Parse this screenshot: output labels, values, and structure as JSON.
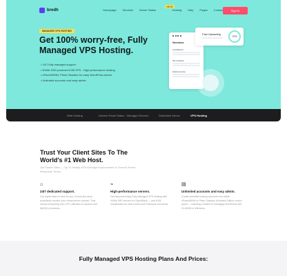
{
  "brand": {
    "name": "bredh",
    "accent": "#7ee8dc",
    "cta_color": "#ff4d6a"
  },
  "nav": {
    "links": [
      "Homepage",
      "Services",
      "Server Status",
      "Hosting",
      "Help",
      "Pages",
      "Contact us"
    ],
    "badge": "NEW",
    "signin": "Sign in"
  },
  "hero": {
    "tag": "MANAGED VPS HOSTING",
    "title": "Get 100% worry-free, Fully Managed VPS Hosting.",
    "features": [
      "24/7 fully managed support.",
      "NVMe SSD powered KVM VPS - High performance hosting",
      "cPanel/WHM, Plesk Obsidian for easy WordPress admin.",
      "Unlimited accounts and easy admin."
    ],
    "panel": {
      "title": "Services",
      "rows": [
        "Load Balancer",
        "SSL Certificate",
        "Website Security"
      ]
    },
    "popup": {
      "text": "Fast Uploading",
      "percent": "72%"
    }
  },
  "tabs": [
    "Web Hosting",
    "Internet Panel Status - Managed Servers",
    "Dedicated Server",
    "VPS Hosting"
  ],
  "trust": {
    "title": "Trust Your Client Sites To The World's #1 Web Host.",
    "subtitle": "Get Faster Sites — Up To Nearly 40% Average Improvement In Overall Server Response Times.",
    "columns": [
      {
        "icon": "headset-icon",
        "title": "24/7 dedicated support.",
        "text": "Our expert team is here for you. Round-the-clock proactively monitor your virtual server channel. That means everything from CPU utilization to Apache and MySQL processes."
      },
      {
        "icon": "chart-icon",
        "title": "High-performance servers.",
        "text": "Get fast-performing Fully Managed VPS Hosting with NVMe SSD servers on OpenStack — and KVM virtualization for best control over hardware resources."
      },
      {
        "icon": "server-icon",
        "title": "Unlimited accounts and easy admin.",
        "text": "Create unlimited hosting accounts from either cPanel/WHM or Plesk Obsidian Unlimited Edition control panel — including a toolkit for managing WordPress site. Go WHM or Windows."
      }
    ]
  },
  "plans": {
    "title": "Fully Managed VPS Hosting Plans And Prices:"
  }
}
